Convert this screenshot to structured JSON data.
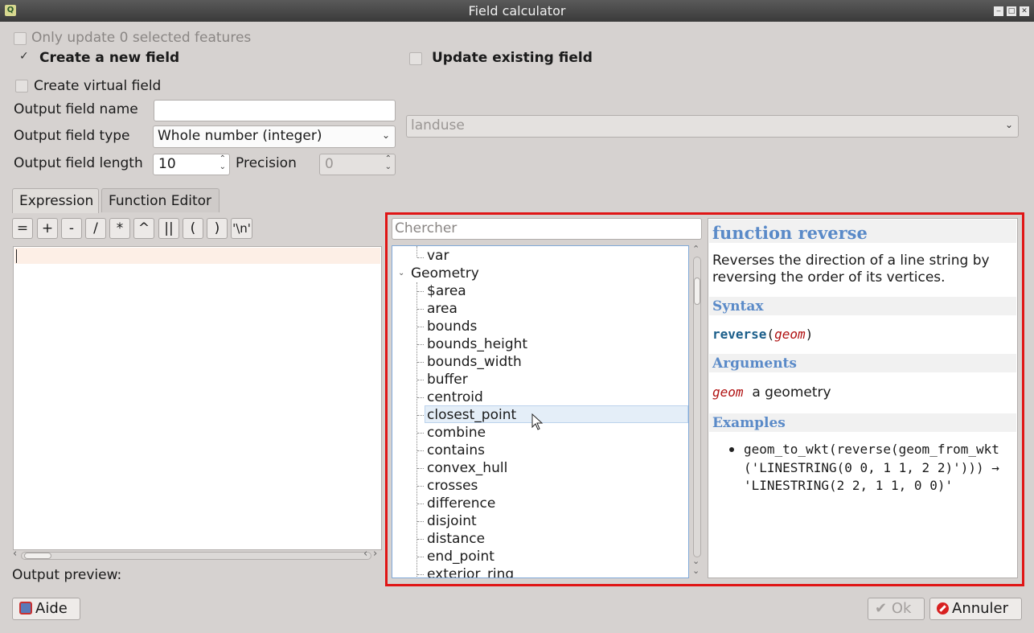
{
  "window": {
    "title": "Field calculator"
  },
  "options": {
    "only_update": "Only update 0 selected features",
    "create_new_field": "Create a new field",
    "update_existing": "Update existing field",
    "create_virtual": "Create virtual field",
    "output_field_name_label": "Output field name",
    "output_field_name_value": "",
    "output_field_type_label": "Output field type",
    "output_field_type_value": "Whole number (integer)",
    "output_field_length_label": "Output field length",
    "output_field_length_value": "10",
    "precision_label": "Precision",
    "precision_value": "0",
    "existing_field_value": "landuse"
  },
  "tabs": [
    "Expression",
    "Function Editor"
  ],
  "operators": [
    "=",
    "+",
    "-",
    "/",
    "*",
    "^",
    "||",
    "(",
    ")",
    "'\\n'"
  ],
  "output_preview_label": "Output preview:",
  "search": {
    "placeholder": "Chercher"
  },
  "tree": {
    "items": [
      "var",
      "Geometry",
      "$area",
      "area",
      "bounds",
      "bounds_height",
      "bounds_width",
      "buffer",
      "centroid",
      "closest_point",
      "combine",
      "contains",
      "convex_hull",
      "crosses",
      "difference",
      "disjoint",
      "distance",
      "end_point",
      "exterior_ring"
    ],
    "selected": "closest_point"
  },
  "help": {
    "title": "function reverse",
    "description": "Reverses the direction of a line string by reversing the order of its vertices.",
    "syntax_heading": "Syntax",
    "syntax_fn": "reverse",
    "syntax_open": "(",
    "syntax_arg": "geom",
    "syntax_close": ")",
    "arguments_heading": "Arguments",
    "arg_name": "geom",
    "arg_desc": "a geometry",
    "examples_heading": "Examples",
    "example": "geom_to_wkt(reverse(geom_from_wkt('LINESTRING(0 0, 1 1, 2 2)'))) → 'LINESTRING(2 2, 1 1, 0 0)'"
  },
  "buttons": {
    "help": "Aide",
    "ok": "Ok",
    "cancel": "Annuler"
  },
  "colors": {
    "highlight_border": "#e01515",
    "help_heading": "#5a8ac8",
    "syntax_fn": "#1b5e8a",
    "syntax_arg": "#b01010"
  }
}
